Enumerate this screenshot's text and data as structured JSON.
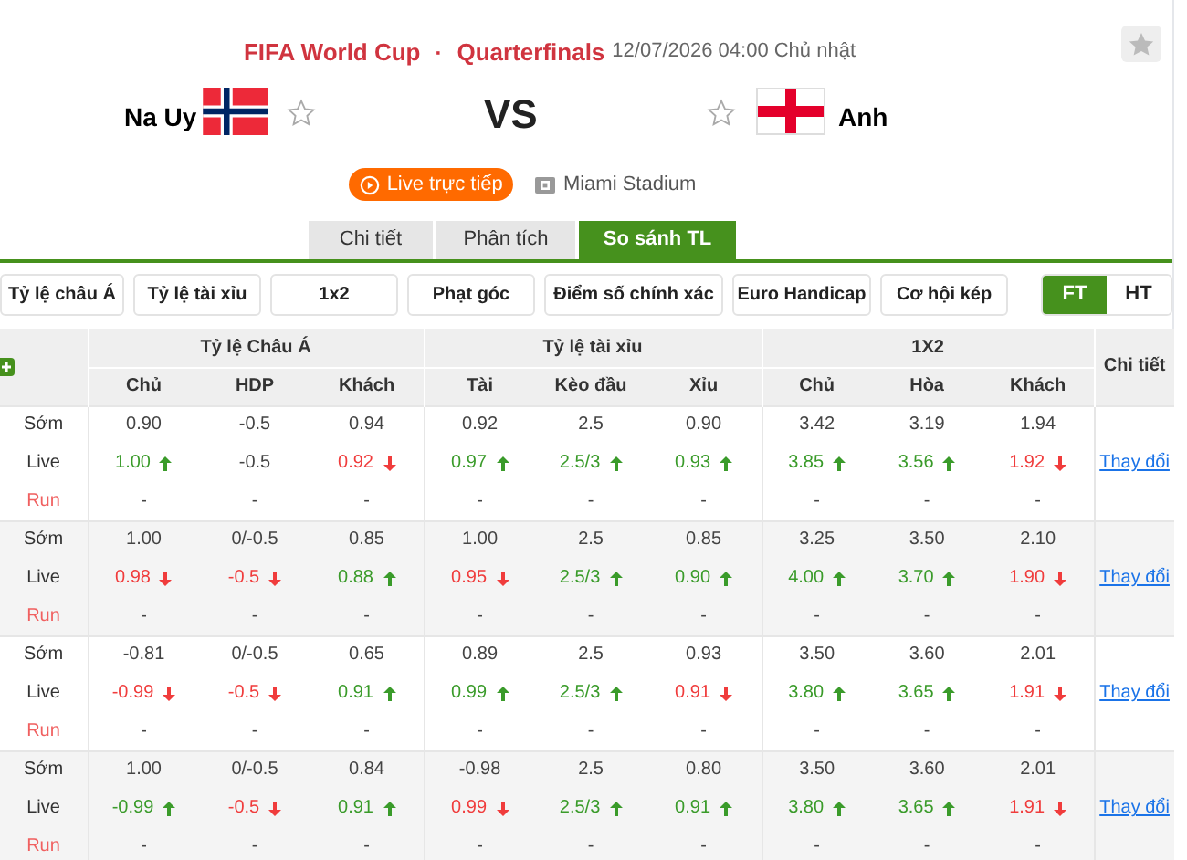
{
  "match": {
    "competition": "FIFA World Cup",
    "separator": "·",
    "round": "Quarterfinals",
    "datetime": "12/07/2026 04:00 Chủ nhật",
    "favorite": false,
    "home": {
      "name": "Na Uy",
      "favorite": false
    },
    "vs": "VS",
    "away": {
      "name": "Anh",
      "favorite": false
    },
    "live_button": "Live trực tiếp",
    "stadium": "Miami Stadium"
  },
  "tabs": [
    {
      "label": "Chi tiết",
      "selected": false
    },
    {
      "label": "Phân tích",
      "selected": false
    },
    {
      "label": "So sánh TL",
      "selected": true
    }
  ],
  "filters": [
    "Tỷ lệ châu Á",
    "Tỷ lệ tài xỉu",
    "1x2",
    "Phạt góc",
    "Điểm số chính xác",
    "Euro Handicap",
    "Cơ hội kép"
  ],
  "period_toggle": [
    {
      "label": "FT",
      "selected": true
    },
    {
      "label": "HT",
      "selected": false
    }
  ],
  "table": {
    "groups": [
      "Tỷ lệ Châu Á",
      "Tỷ lệ tài xỉu",
      "1X2"
    ],
    "detail_header": "Chi tiết",
    "columns": [
      "Chủ",
      "HDP",
      "Khách",
      "Tài",
      "Kèo đầu",
      "Xỉu",
      "Chủ",
      "Hòa",
      "Khách"
    ],
    "bookmakers": [
      {
        "link": "Thay đổi",
        "rows": [
          {
            "label": "Sớm",
            "kind": "early",
            "values": [
              {
                "text": "0.90"
              },
              {
                "text": "-0.5"
              },
              {
                "text": "0.94"
              },
              {
                "text": "0.92"
              },
              {
                "text": "2.5"
              },
              {
                "text": "0.90"
              },
              {
                "text": "3.42"
              },
              {
                "text": "3.19"
              },
              {
                "text": "1.94"
              }
            ]
          },
          {
            "label": "Live",
            "kind": "live",
            "values": [
              {
                "text": "1.00",
                "up": true
              },
              {
                "text": "-0.5"
              },
              {
                "text": "0.92",
                "up": false
              },
              {
                "text": "0.97",
                "up": true
              },
              {
                "text": "2.5/3",
                "up": true
              },
              {
                "text": "0.93",
                "up": true
              },
              {
                "text": "3.85",
                "up": true
              },
              {
                "text": "3.56",
                "up": true
              },
              {
                "text": "1.92",
                "up": false
              }
            ]
          },
          {
            "label": "Run",
            "kind": "run",
            "values": [
              {
                "text": "-"
              },
              {
                "text": "-"
              },
              {
                "text": "-"
              },
              {
                "text": "-"
              },
              {
                "text": "-"
              },
              {
                "text": "-"
              },
              {
                "text": "-"
              },
              {
                "text": "-"
              },
              {
                "text": "-"
              }
            ]
          }
        ]
      },
      {
        "link": "Thay đổi",
        "rows": [
          {
            "label": "Sớm",
            "kind": "early",
            "values": [
              {
                "text": "1.00"
              },
              {
                "text": "0/-0.5"
              },
              {
                "text": "0.85"
              },
              {
                "text": "1.00"
              },
              {
                "text": "2.5"
              },
              {
                "text": "0.85"
              },
              {
                "text": "3.25"
              },
              {
                "text": "3.50"
              },
              {
                "text": "2.10"
              }
            ]
          },
          {
            "label": "Live",
            "kind": "live",
            "values": [
              {
                "text": "0.98",
                "up": false
              },
              {
                "text": "-0.5",
                "up": false
              },
              {
                "text": "0.88",
                "up": true
              },
              {
                "text": "0.95",
                "up": false
              },
              {
                "text": "2.5/3",
                "up": true
              },
              {
                "text": "0.90",
                "up": true
              },
              {
                "text": "4.00",
                "up": true
              },
              {
                "text": "3.70",
                "up": true
              },
              {
                "text": "1.90",
                "up": false
              }
            ]
          },
          {
            "label": "Run",
            "kind": "run",
            "values": [
              {
                "text": "-"
              },
              {
                "text": "-"
              },
              {
                "text": "-"
              },
              {
                "text": "-"
              },
              {
                "text": "-"
              },
              {
                "text": "-"
              },
              {
                "text": "-"
              },
              {
                "text": "-"
              },
              {
                "text": "-"
              }
            ]
          }
        ]
      },
      {
        "link": "Thay đổi",
        "rows": [
          {
            "label": "Sớm",
            "kind": "early",
            "values": [
              {
                "text": "-0.81"
              },
              {
                "text": "0/-0.5"
              },
              {
                "text": "0.65"
              },
              {
                "text": "0.89"
              },
              {
                "text": "2.5"
              },
              {
                "text": "0.93"
              },
              {
                "text": "3.50"
              },
              {
                "text": "3.60"
              },
              {
                "text": "2.01"
              }
            ]
          },
          {
            "label": "Live",
            "kind": "live",
            "values": [
              {
                "text": "-0.99",
                "up": false
              },
              {
                "text": "-0.5",
                "up": false
              },
              {
                "text": "0.91",
                "up": true
              },
              {
                "text": "0.99",
                "up": true
              },
              {
                "text": "2.5/3",
                "up": true
              },
              {
                "text": "0.91",
                "up": false
              },
              {
                "text": "3.80",
                "up": true
              },
              {
                "text": "3.65",
                "up": true
              },
              {
                "text": "1.91",
                "up": false
              }
            ]
          },
          {
            "label": "Run",
            "kind": "run",
            "values": [
              {
                "text": "-"
              },
              {
                "text": "-"
              },
              {
                "text": "-"
              },
              {
                "text": "-"
              },
              {
                "text": "-"
              },
              {
                "text": "-"
              },
              {
                "text": "-"
              },
              {
                "text": "-"
              },
              {
                "text": "-"
              }
            ]
          }
        ]
      },
      {
        "link": "Thay đổi",
        "rows": [
          {
            "label": "Sớm",
            "kind": "early",
            "values": [
              {
                "text": "1.00"
              },
              {
                "text": "0/-0.5"
              },
              {
                "text": "0.84"
              },
              {
                "text": "-0.98"
              },
              {
                "text": "2.5"
              },
              {
                "text": "0.80"
              },
              {
                "text": "3.50"
              },
              {
                "text": "3.60"
              },
              {
                "text": "2.01"
              }
            ]
          },
          {
            "label": "Live",
            "kind": "live",
            "values": [
              {
                "text": "-0.99",
                "up": true
              },
              {
                "text": "-0.5",
                "up": false
              },
              {
                "text": "0.91",
                "up": true
              },
              {
                "text": "0.99",
                "up": false
              },
              {
                "text": "2.5/3",
                "up": true
              },
              {
                "text": "0.91",
                "up": true
              },
              {
                "text": "3.80",
                "up": true
              },
              {
                "text": "3.65",
                "up": true
              },
              {
                "text": "1.91",
                "up": false
              }
            ]
          },
          {
            "label": "Run",
            "kind": "run",
            "values": [
              {
                "text": "-"
              },
              {
                "text": "-"
              },
              {
                "text": "-"
              },
              {
                "text": "-"
              },
              {
                "text": "-"
              },
              {
                "text": "-"
              },
              {
                "text": "-"
              },
              {
                "text": "-"
              },
              {
                "text": "-"
              }
            ]
          }
        ]
      }
    ]
  }
}
